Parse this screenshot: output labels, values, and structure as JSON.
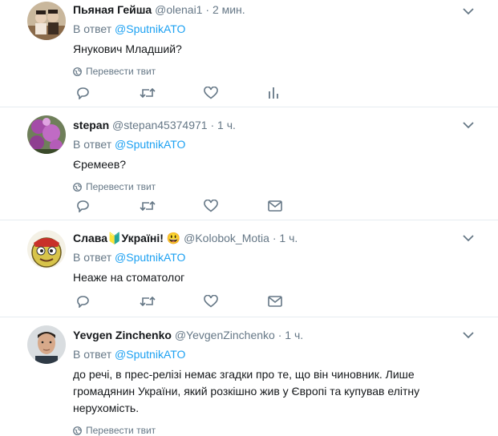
{
  "tweets": [
    {
      "name": "Пьяная Гейша",
      "handle": "@olenai1",
      "time": "2 мин.",
      "reply_prefix": "В ответ",
      "reply_to": "@SputnikATO",
      "text": "Янукович Младший?",
      "translate": "Перевести твит",
      "actions": [
        "reply-icon",
        "retweet-icon",
        "like-icon",
        "analytics-icon"
      ]
    },
    {
      "name": "stepan",
      "handle": "@stepan45374971",
      "time": "1 ч.",
      "reply_prefix": "В ответ",
      "reply_to": "@SputnikATO",
      "text": "Єремеев?",
      "translate": "Перевести твит",
      "actions": [
        "reply-icon",
        "retweet-icon",
        "like-icon",
        "message-icon"
      ]
    },
    {
      "name_parts": [
        "Слава",
        "🔰",
        "Україні!",
        "😃"
      ],
      "handle": "@Kolobok_Motia",
      "time": "1 ч.",
      "reply_prefix": "В ответ",
      "reply_to": "@SputnikATO",
      "text": "Неаже на стоматолог",
      "actions": [
        "reply-icon",
        "retweet-icon",
        "like-icon",
        "message-icon"
      ]
    },
    {
      "name": "Yevgen Zinchenko",
      "handle": "@YevgenZinchenko",
      "time": "1 ч.",
      "reply_prefix": "В ответ",
      "reply_to": "@SputnikATO",
      "text_lines": [
        "до речі, в прес-релізі немає згадки про те, що він чиновник. Лише",
        "громадянин України, який розкішно жив у Європі та купував елітну",
        "нерухомість."
      ],
      "translate": "Перевести твит"
    }
  ],
  "separator": "·",
  "colors": {
    "link": "#1da1f2",
    "muted": "#657786",
    "border": "#e6ecf0"
  }
}
